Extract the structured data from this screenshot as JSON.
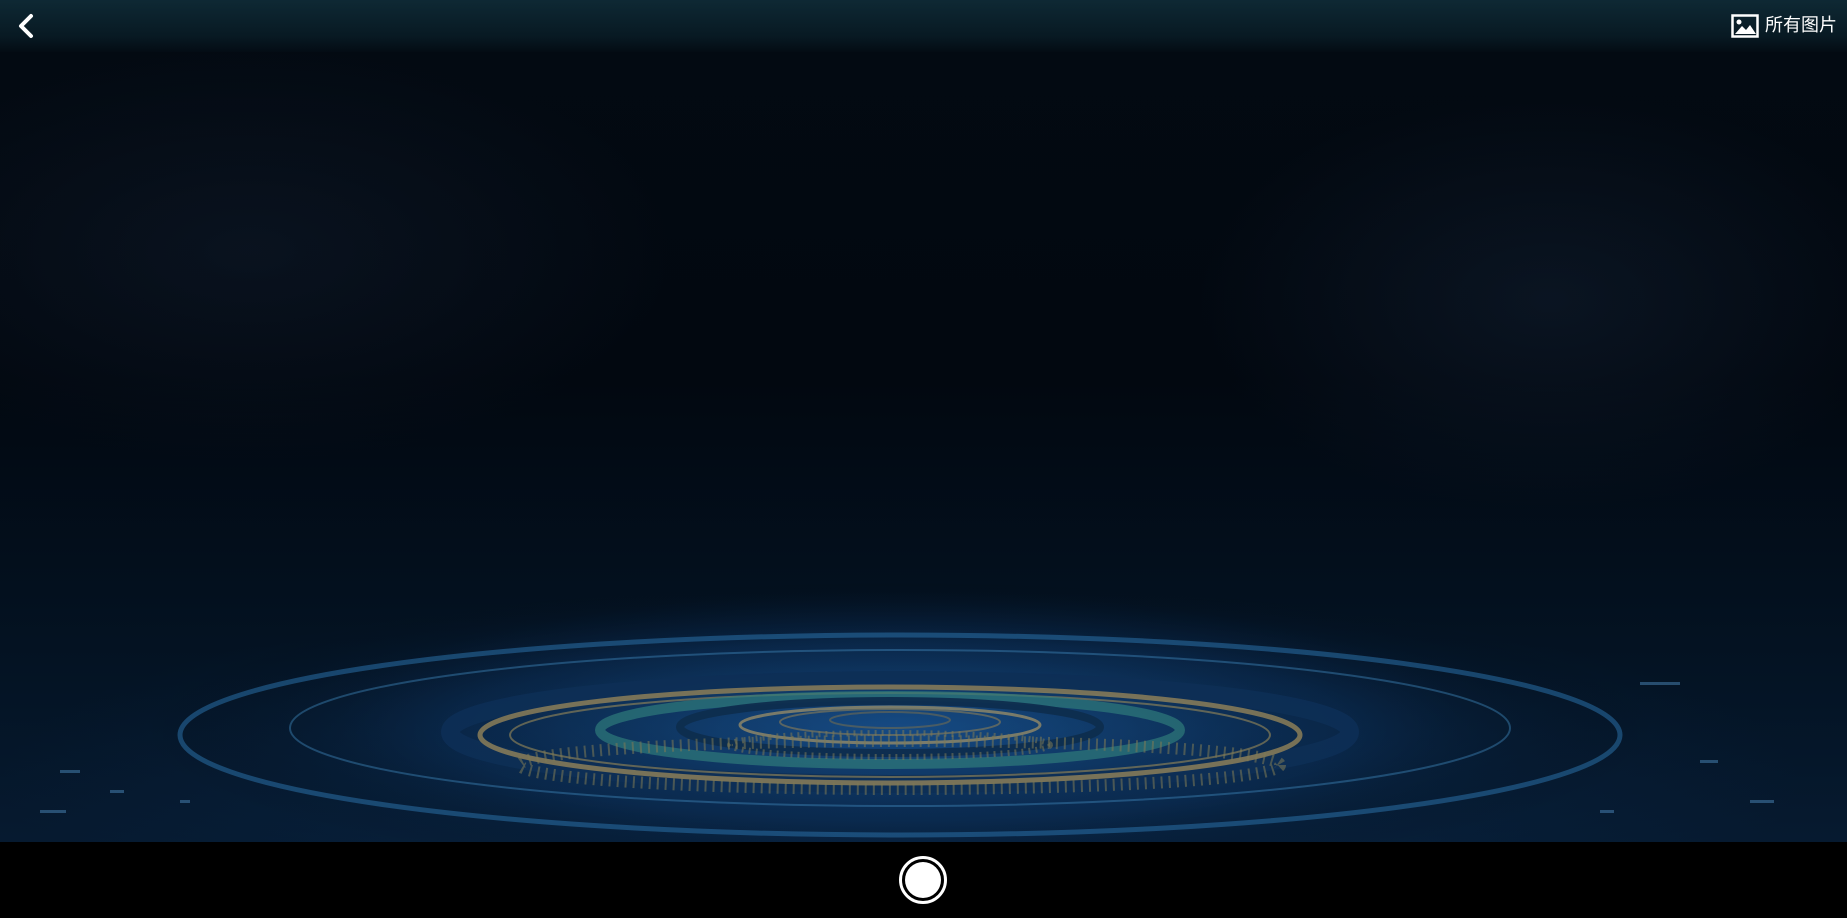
{
  "header": {
    "back_icon": "chevron-left-icon",
    "gallery_icon": "image-icon",
    "gallery_label": "所有图片"
  },
  "controls": {
    "shutter_icon": "shutter-circle-icon"
  },
  "colors": {
    "toolbar_text": "#ffffff",
    "bottom_bar": "#000000",
    "glow_accent": "#1c5a9c"
  }
}
